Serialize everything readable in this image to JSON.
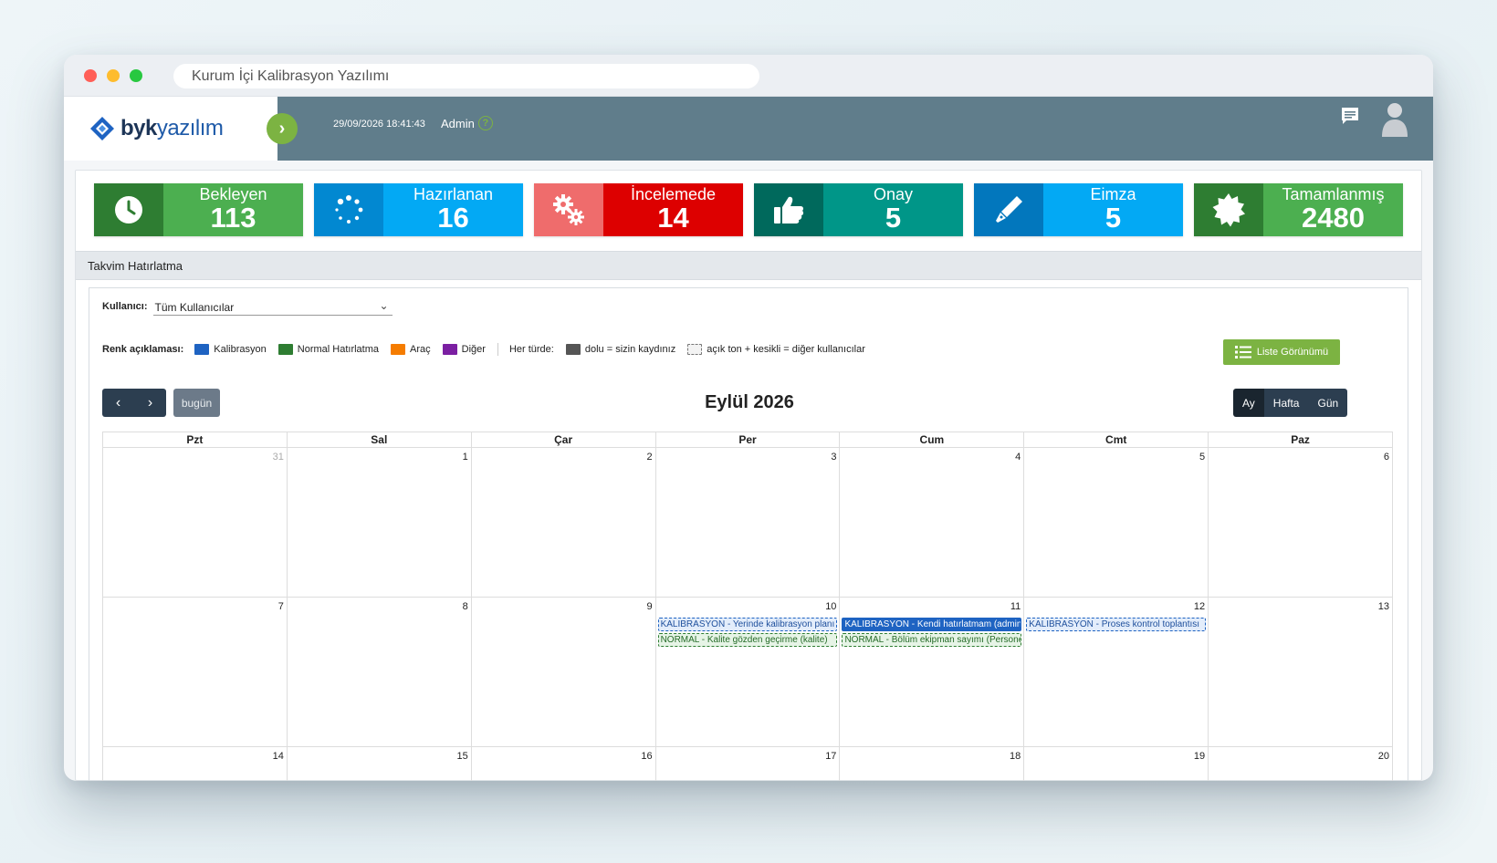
{
  "window": {
    "url_title": "Kurum İçi Kalibrasyon Yazılımı"
  },
  "header": {
    "logo_bold": "byk",
    "logo_rest": "yazılım",
    "datetime": "29/09/2026 18:41:43",
    "user": "Admin"
  },
  "stats": [
    {
      "label": "Bekleyen",
      "value": "113",
      "icon": "clock-icon",
      "icon_bg": "#2e7d32",
      "bg": "#4caf50"
    },
    {
      "label": "Hazırlanan",
      "value": "16",
      "icon": "spinner-icon",
      "icon_bg": "#0288d1",
      "bg": "#03a9f4"
    },
    {
      "label": "İncelemede",
      "value": "14",
      "icon": "gears-icon",
      "icon_bg": "#ef6c6c",
      "bg": "#dd0000"
    },
    {
      "label": "Onay",
      "value": "5",
      "icon": "thumbs-up-icon",
      "icon_bg": "#00695c",
      "bg": "#009688"
    },
    {
      "label": "Eimza",
      "value": "5",
      "icon": "pen-icon",
      "icon_bg": "#0277bd",
      "bg": "#03a9f4"
    },
    {
      "label": "Tamamlanmış",
      "value": "2480",
      "icon": "badge-icon",
      "icon_bg": "#2e7d32",
      "bg": "#4caf50"
    }
  ],
  "section": {
    "title": "Takvim Hatırlatma"
  },
  "filter": {
    "label": "Kullanıcı:",
    "selected": "Tüm Kullanıcılar"
  },
  "legend": {
    "title": "Renk açıklaması:",
    "items": [
      {
        "label": "Kalibrasyon",
        "color": "#1e63c2"
      },
      {
        "label": "Normal Hatırlatma",
        "color": "#2e7d32"
      },
      {
        "label": "Araç",
        "color": "#f57c00"
      },
      {
        "label": "Diğer",
        "color": "#7b1fa2"
      }
    ],
    "type_label": "Her türde:",
    "solid_label": "dolu = sizin kaydınız",
    "dashed_label": "açık ton + kesikli = diğer kullanıcılar"
  },
  "list_view_button": "Liste Görünümü",
  "calendar": {
    "today_button": "bugün",
    "title": "Eylül 2026",
    "views": [
      "Ay",
      "Hafta",
      "Gün"
    ],
    "weekdays": [
      "Pzt",
      "Sal",
      "Çar",
      "Per",
      "Cum",
      "Cmt",
      "Paz"
    ],
    "week1": [
      "31",
      "1",
      "2",
      "3",
      "4",
      "5",
      "6"
    ],
    "week2": [
      "7",
      "8",
      "9",
      "10",
      "11",
      "12",
      "13"
    ],
    "week3": [
      "14",
      "15",
      "16",
      "17",
      "18",
      "19",
      "20"
    ],
    "events": {
      "thu_kal": "KALIBRASYON - Yerinde kalibrasyon planı",
      "thu_nor": "NORMAL - Kalite gözden geçirme (kalite)",
      "fri_kal": "KALIBRASYON - Kendi hatırlatmam (admin)",
      "fri_nor": "NORMAL - Bölüm ekipman sayımı (Personel)",
      "sat_kal": "KALIBRASYON - Proses kontrol toplantısı"
    }
  }
}
